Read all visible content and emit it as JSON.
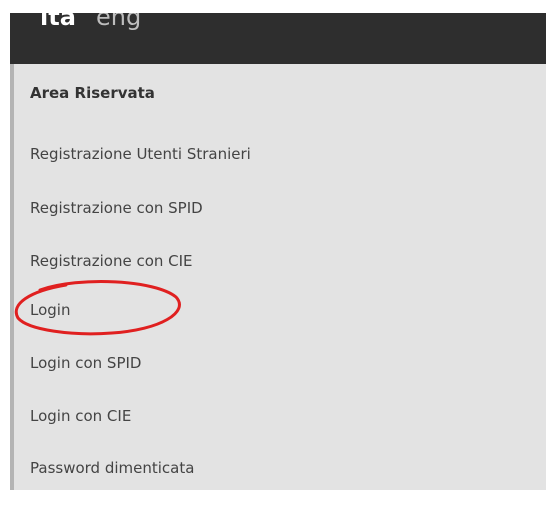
{
  "languages": {
    "active": "ita",
    "other": "eng"
  },
  "menu": {
    "heading": "Area Riservata",
    "items": [
      {
        "label": "Registrazione Utenti Stranieri"
      },
      {
        "label": "Registrazione con SPID"
      },
      {
        "label": "Registrazione con CIE"
      },
      {
        "label": "Login"
      },
      {
        "label": "Login con SPID"
      },
      {
        "label": "Login con CIE"
      },
      {
        "label": "Password dimenticata"
      }
    ]
  },
  "annotation": {
    "type": "ellipse",
    "color": "#e02020"
  }
}
